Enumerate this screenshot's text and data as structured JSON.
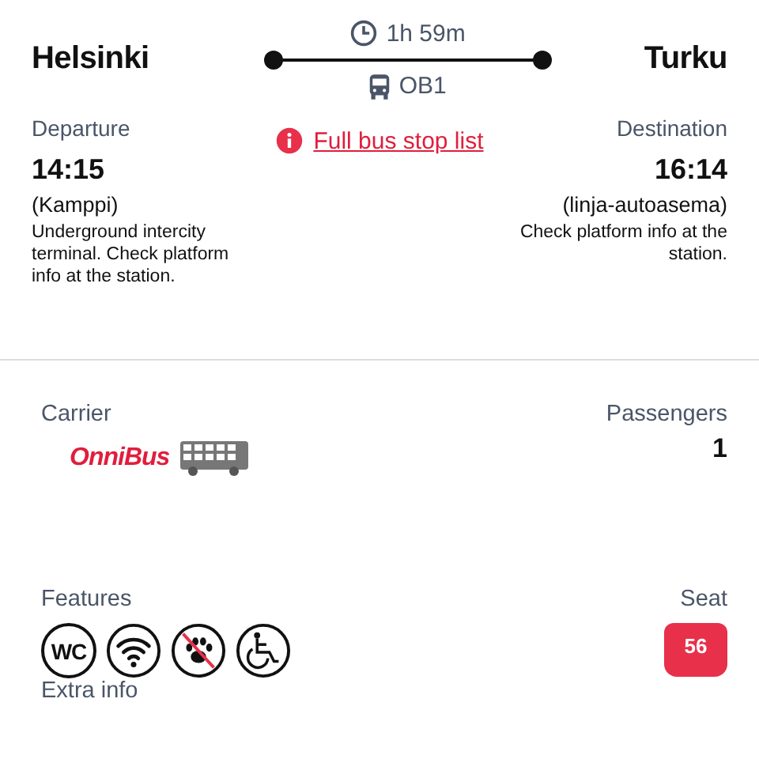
{
  "route": {
    "origin": "Helsinki",
    "destination": "Turku",
    "duration": "1h 59m",
    "line": "OB1"
  },
  "departure": {
    "label": "Departure",
    "time": "14:15",
    "stop": "(Kamppi)",
    "note": "Underground intercity terminal. Check platform info at the station."
  },
  "stop_list_link": "Full bus stop list",
  "arrival": {
    "label": "Destination",
    "time": "16:14",
    "stop": "(linja-autoasema)",
    "note": "Check platform info at the station."
  },
  "carrier": {
    "label": "Carrier",
    "name": "OnniBus"
  },
  "passengers": {
    "label": "Passengers",
    "count": "1"
  },
  "features": {
    "label": "Features",
    "items": [
      {
        "kind": "wc",
        "text": "WC"
      },
      {
        "kind": "wifi"
      },
      {
        "kind": "no-pets"
      },
      {
        "kind": "wheelchair"
      }
    ]
  },
  "seat": {
    "label": "Seat",
    "number": "56"
  },
  "extra_info": {
    "label": "Extra info"
  }
}
